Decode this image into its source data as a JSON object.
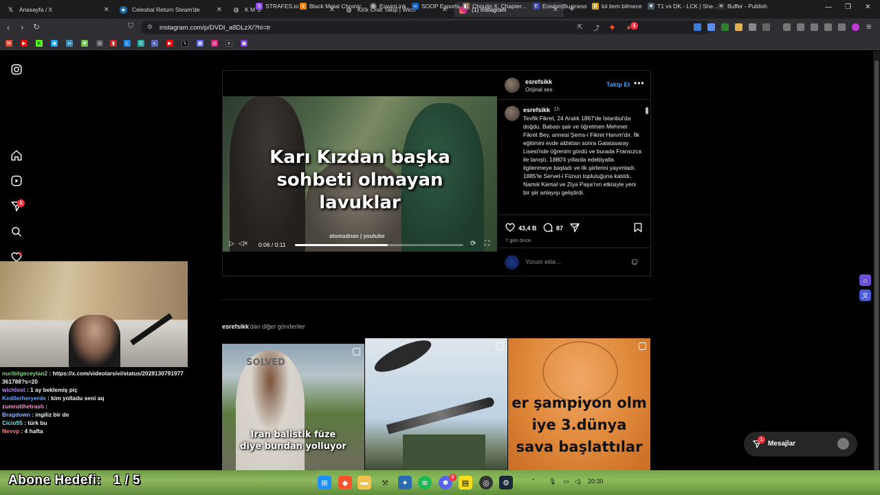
{
  "browser": {
    "tabs": [
      {
        "label": "Anasayfa / X",
        "icon": "x-logo-icon"
      },
      {
        "label": "Celestial Return Steam'de",
        "icon": "steam-icon"
      },
      {
        "label": "K M S",
        "icon": "globe-icon"
      },
      {
        "label": "Kick Chat Takip | Wich",
        "icon": "globe-icon"
      },
      {
        "label": "(1) Instagram",
        "icon": "instagram-icon",
        "active": true
      }
    ],
    "url": "instagram.com/p/DVDI_a8DLzX/?hl=tr",
    "bookmarks": [
      "STRAFES.io",
      "Black Metal Chronic...",
      "EowinLink",
      "SOOP Esports",
      "Choujin X, Chapter...",
      "Eowinn|Business",
      "lol item bilmece",
      "T1 vs DK - LCK | She...",
      "Buffer - Publish"
    ],
    "notification_badge": "1"
  },
  "instagram": {
    "sidebar_badge": "1",
    "post": {
      "username": "esrefsikk",
      "audio": "Orijinal ses",
      "follow_label": "Takip Et",
      "video_caption": [
        "Karı Kızdan başka",
        "sohbeti olmayan",
        "lavuklar"
      ],
      "watermark": "atomadnan | youtube",
      "video_time": "0:06 / 0:11",
      "video_progress": 0.55,
      "comment_time": "1h",
      "description": "Tevfik Fikret, 24 Aralık 1867'de İstanbul'da doğdu. Babası şair ve öğretmen Mehmet Fikret Bey, annesi Şems-i Fikret Hanım'dır. İlk eğitimini evde aldıktan sonra Galatasaray Lisesi'nde öğrenim gördü ve burada Fransızca ile tanıştı. 1880'li yıllarda edebiyatla ilgilenmeye başladı ve ilk şiirlerini yayımladı. 1885'te Servet-i Fünun topluluğuna katıldı. Namık Kemal ve Ziya Paşa'nın etkisiyle yeni bir şiir anlayışı geliştirdi.",
      "likes": "43,4 B",
      "comments": "87",
      "posted": "7 gün önce",
      "add_comment_placeholder": "Yorum ekle..."
    },
    "more_posts": {
      "username": "esrefsikk",
      "suffix": "'dan diğer gönderiler",
      "items": [
        {
          "overlay": "Iran balistik füze diye bundan yolluyor",
          "overlay_top": "SOLVED"
        },
        {
          "overlay": ""
        },
        {
          "overlay": "er şampiyon olm iye 3.dünya sava başlattılar"
        }
      ]
    },
    "messages": {
      "label": "Mesajlar",
      "badge": "1"
    }
  },
  "stream": {
    "chat": [
      {
        "user": "nuribilgeceylan2",
        "color": "#7fe07f",
        "text": "https://x.com/videolarsivi/status/2028130791977361788?s=20"
      },
      {
        "user": "wichlost",
        "color": "#c58af9",
        "text": "1 ay beklemiş piç"
      },
      {
        "user": "Kedilerheryerde",
        "color": "#6aa6ff",
        "text": "kim yolladu seni aq"
      },
      {
        "user": "zumrutthetrash",
        "color": "#ff8fd0",
        "text": ""
      },
      {
        "user": "Bragdown",
        "color": "#8fb5ff",
        "text": "ingiliz bir de"
      },
      {
        "user": "Cicio55",
        "color": "#7fe0e0",
        "text": "türk bu"
      },
      {
        "user": "Nevvp",
        "color": "#ff8080",
        "text": "4 hafta"
      }
    ],
    "goal": "Abone Hedefi:   1 / 5"
  },
  "taskbar": {
    "clock": "20:30",
    "discord_badge": "9"
  },
  "colors": {
    "accent": "#4a9df8",
    "badge": "#ff3040",
    "bg": "#000000"
  }
}
